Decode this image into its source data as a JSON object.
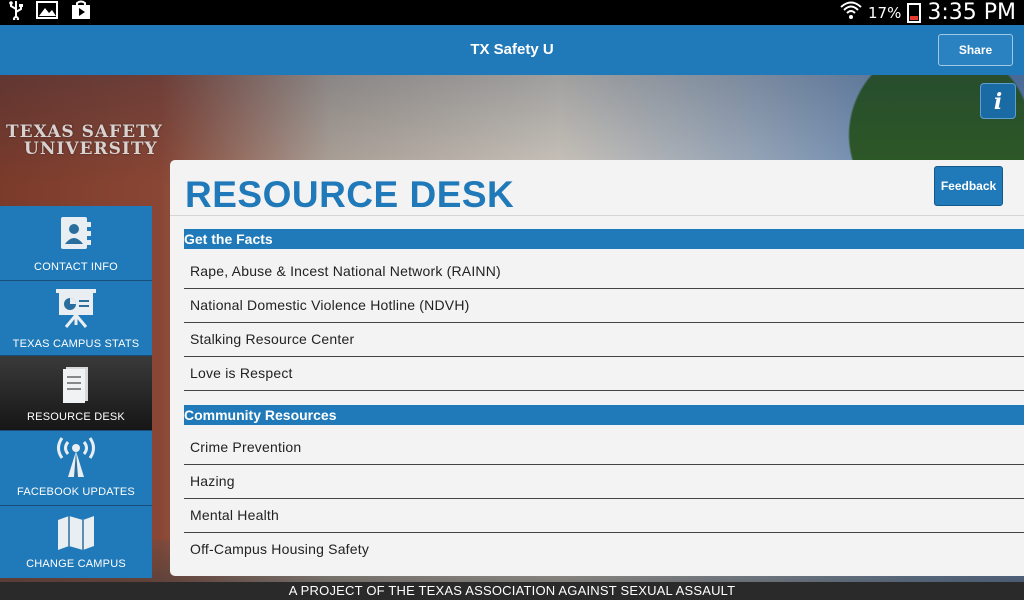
{
  "status_bar": {
    "battery_percent": "17%",
    "time": "3:35 PM",
    "icons": [
      "usb-icon",
      "image-icon",
      "play-store-icon",
      "wifi-icon",
      "battery-icon"
    ]
  },
  "app_bar": {
    "title": "TX Safety U",
    "share_label": "Share"
  },
  "hero": {
    "brand_line1": "TEXAS SAFETY",
    "brand_line2": "UNIVERSITY",
    "info_label": "i"
  },
  "sidenav": {
    "items": [
      {
        "label": "CONTACT INFO",
        "icon": "contact-book-icon"
      },
      {
        "label": "TEXAS CAMPUS STATS",
        "icon": "presentation-board-icon"
      },
      {
        "label": "RESOURCE DESK",
        "icon": "document-icon",
        "active": true
      },
      {
        "label": "FACEBOOK UPDATES",
        "icon": "broadcast-tower-icon"
      },
      {
        "label": "CHANGE CAMPUS",
        "icon": "map-icon"
      }
    ]
  },
  "panel": {
    "title": "RESOURCE DESK",
    "feedback_label": "Feedback",
    "sections": [
      {
        "header": "Get the Facts",
        "items": [
          "Rape, Abuse & Incest National Network (RAINN)",
          "National Domestic Violence Hotline (NDVH)",
          "Stalking Resource Center",
          "Love is Respect"
        ]
      },
      {
        "header": "Community Resources",
        "items": [
          "Crime Prevention",
          "Hazing",
          "Mental Health",
          "Off-Campus Housing Safety"
        ]
      }
    ]
  },
  "footer": {
    "text": "A PROJECT OF THE TEXAS ASSOCIATION AGAINST SEXUAL ASSAULT"
  },
  "colors": {
    "accent": "#2079b8",
    "status_bar": "#000000",
    "active_nav": "#1e1e1e"
  }
}
